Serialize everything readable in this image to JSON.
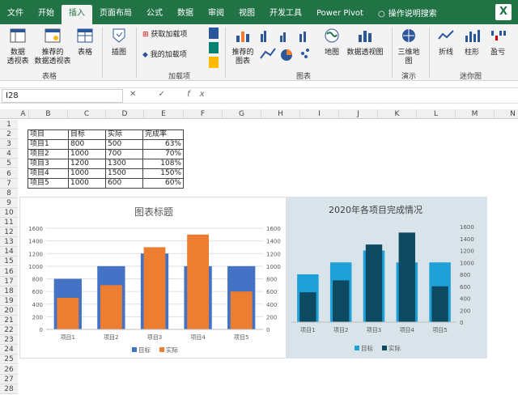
{
  "tabs": [
    "文件",
    "开始",
    "插入",
    "页面布局",
    "公式",
    "数据",
    "审阅",
    "视图",
    "开发工具",
    "Power Pivot",
    "操作说明搜索"
  ],
  "active_tab": "插入",
  "ribbon": {
    "groups": [
      "表格",
      "加载项",
      "图表",
      "演示",
      "迷你图"
    ],
    "buttons": [
      "数据透视表",
      "推荐的数据透视表",
      "表格",
      "插图",
      "获取加载项",
      "我的加载项",
      "推荐的图表",
      "地图",
      "数据透视图",
      "三维地图",
      "折线",
      "柱形",
      "盈亏"
    ]
  },
  "formula": {
    "namebox": "I28",
    "fx": "fx"
  },
  "columns": [
    "A",
    "B",
    "C",
    "D",
    "E",
    "F",
    "G",
    "H",
    "I",
    "J",
    "K",
    "L",
    "M",
    "N"
  ],
  "rows": [
    "1",
    "2",
    "3",
    "4",
    "5",
    "6",
    "7",
    "8",
    "9",
    "10",
    "11",
    "12",
    "13",
    "14",
    "15",
    "16",
    "17",
    "18",
    "19",
    "20",
    "21",
    "22",
    "23",
    "24",
    "25",
    "26",
    "27",
    "28"
  ],
  "table": {
    "header": [
      "项目",
      "目标",
      "实际",
      "完成率"
    ],
    "rows": [
      [
        "项目1",
        "800",
        "500",
        "63%"
      ],
      [
        "项目2",
        "1000",
        "700",
        "70%"
      ],
      [
        "项目3",
        "1200",
        "1300",
        "108%"
      ],
      [
        "项目4",
        "1000",
        "1500",
        "150%"
      ],
      [
        "项目5",
        "1000",
        "600",
        "60%"
      ]
    ]
  },
  "chart_data": [
    {
      "type": "bar",
      "title": "图表标题",
      "categories": [
        "项目1",
        "项目2",
        "项目3",
        "项目4",
        "项目5"
      ],
      "series": [
        {
          "name": "目标",
          "values": [
            800,
            1000,
            1200,
            1000,
            1000
          ]
        },
        {
          "name": "实际",
          "values": [
            500,
            700,
            1300,
            1500,
            600
          ]
        }
      ],
      "ylim": [
        0,
        1600
      ],
      "yticks": [
        0,
        200,
        400,
        600,
        800,
        1000,
        1200,
        1400,
        1600
      ],
      "colors": [
        "#4472c4",
        "#ed7d31"
      ],
      "legend": "bottom",
      "grid": true
    },
    {
      "type": "bar",
      "title": "2020年各项目完成情况",
      "categories": [
        "项目1",
        "项目2",
        "项目3",
        "项目4",
        "项目5"
      ],
      "series": [
        {
          "name": "目标",
          "values": [
            800,
            1000,
            1200,
            1000,
            1000
          ]
        },
        {
          "name": "实际",
          "values": [
            500,
            700,
            1300,
            1500,
            600
          ]
        }
      ],
      "ylim": [
        0,
        1600
      ],
      "yticks": [
        0,
        200,
        400,
        600,
        800,
        1000,
        1200,
        1400,
        1600
      ],
      "colors": [
        "#1ea0d8",
        "#0d4a62"
      ],
      "legend": "bottom",
      "grid": false
    }
  ]
}
